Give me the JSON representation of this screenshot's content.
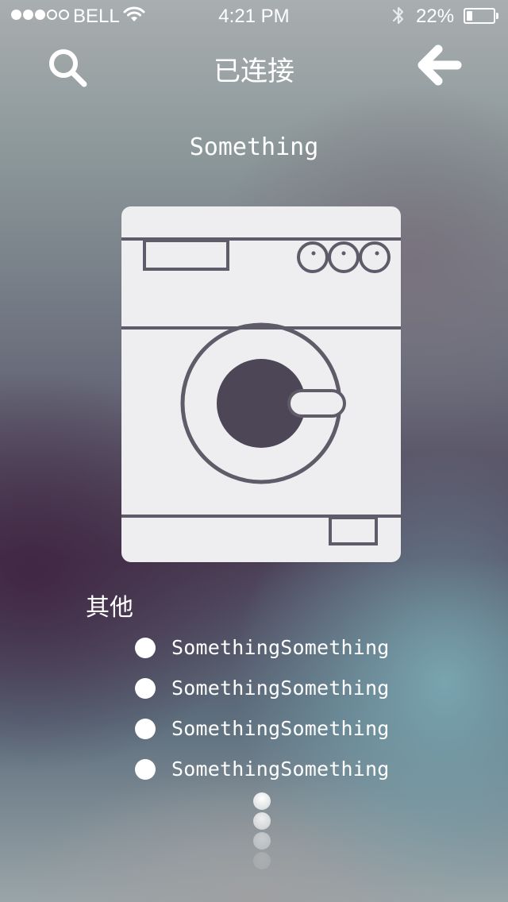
{
  "status_bar": {
    "carrier": "BELL",
    "time": "4:21 PM",
    "battery_percent": "22%",
    "battery_level": 0.22,
    "signal_bars_filled": 3,
    "signal_bars_total": 5,
    "icons": [
      "wifi-icon",
      "bluetooth-icon",
      "battery-icon"
    ]
  },
  "nav": {
    "title": "已连接",
    "left_icon": "search-icon",
    "right_icon": "back-arrow-icon"
  },
  "device": {
    "name": "Something",
    "image_icon": "washing-machine-icon"
  },
  "others": {
    "label": "其他",
    "items": [
      {
        "label": "SomethingSomething"
      },
      {
        "label": "SomethingSomething"
      },
      {
        "label": "SomethingSomething"
      },
      {
        "label": "SomethingSomething"
      }
    ]
  },
  "colors": {
    "card_background": "#eeeef0",
    "washer_stroke": "#5f5b68",
    "washer_drum": "#4c4656",
    "text": "#ffffff"
  }
}
